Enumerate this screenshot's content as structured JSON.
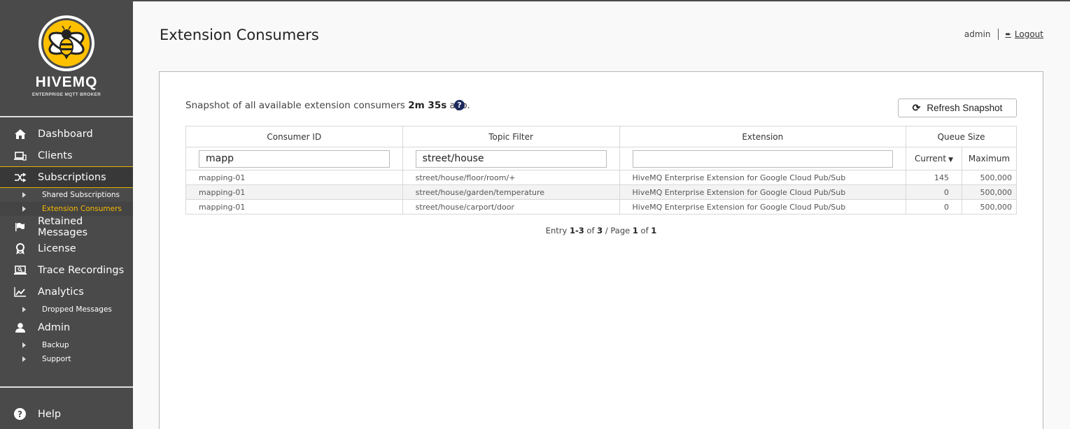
{
  "sidebar": {
    "logo": {
      "name": "HIVEMQ",
      "subtitle": "ENTERPRISE MQTT BROKER",
      "accent": "#ffc000"
    },
    "items": [
      {
        "label": "Dashboard",
        "icon": "home-icon"
      },
      {
        "label": "Clients",
        "icon": "devices-icon"
      },
      {
        "label": "Subscriptions",
        "icon": "shuffle-icon",
        "active": true,
        "children": [
          {
            "label": "Shared Subscriptions"
          },
          {
            "label": "Extension Consumers",
            "current": true
          }
        ]
      },
      {
        "label": "Retained Messages",
        "icon": "flag-icon"
      },
      {
        "label": "License",
        "icon": "award-icon"
      },
      {
        "label": "Trace Recordings",
        "icon": "laptop-search-icon"
      },
      {
        "label": "Analytics",
        "icon": "line-chart-icon",
        "children": [
          {
            "label": "Dropped Messages"
          }
        ]
      },
      {
        "label": "Admin",
        "icon": "user-icon",
        "children": [
          {
            "label": "Backup"
          },
          {
            "label": "Support"
          }
        ]
      }
    ],
    "help": {
      "label": "Help",
      "icon": "question-circle-icon"
    },
    "active_color": "#f6b800"
  },
  "header": {
    "title": "Extension Consumers",
    "user": "admin",
    "logout_label": "Logout"
  },
  "snapshot": {
    "prefix": "Snapshot of all available extension consumers ",
    "age": "2m 35s",
    "suffix": " ago.",
    "help_icon": "?",
    "refresh_label": "Refresh Snapshot"
  },
  "table": {
    "columns": {
      "consumer_id": "Consumer ID",
      "topic_filter": "Topic Filter",
      "extension": "Extension",
      "queue_size": "Queue Size",
      "current": "Current",
      "maximum": "Maximum"
    },
    "filters": {
      "consumer_id": "mapp",
      "topic_filter": "street/house",
      "extension": ""
    },
    "sort": {
      "column": "current",
      "direction": "desc"
    },
    "rows": [
      {
        "consumer_id": "mapping-01",
        "topic_filter": "street/house/floor/room/+",
        "extension": "HiveMQ Enterprise Extension for Google Cloud Pub/Sub",
        "current": "145",
        "maximum": "500,000"
      },
      {
        "consumer_id": "mapping-01",
        "topic_filter": "street/house/garden/temperature",
        "extension": "HiveMQ Enterprise Extension for Google Cloud Pub/Sub",
        "current": "0",
        "maximum": "500,000"
      },
      {
        "consumer_id": "mapping-01",
        "topic_filter": "street/house/carport/door",
        "extension": "HiveMQ Enterprise Extension for Google Cloud Pub/Sub",
        "current": "0",
        "maximum": "500,000"
      }
    ]
  },
  "pagination": {
    "entry_label": "Entry ",
    "range": "1-3",
    "of_label": " of ",
    "total": "3",
    "page_label": " / Page ",
    "page": "1",
    "of_label2": " of ",
    "pages": "1"
  }
}
